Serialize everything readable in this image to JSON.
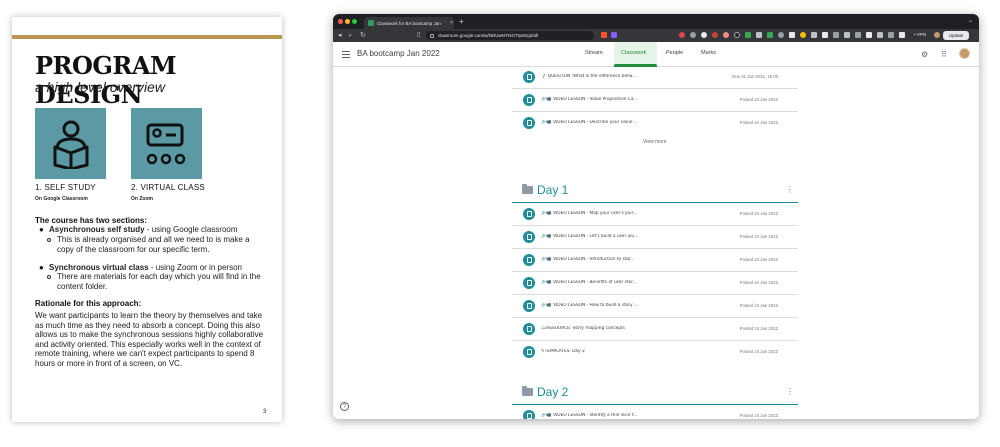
{
  "document": {
    "title": "PROGRAM DESIGN",
    "subtitle": "a high level overview",
    "cards": [
      {
        "label": "1. SELF STUDY",
        "sub": "On Google Classroom",
        "icon": "reading-person-icon"
      },
      {
        "label": "2. VIRTUAL CLASS",
        "sub": "On Zoom",
        "icon": "virtual-class-icon"
      }
    ],
    "sections_heading": "The course has two sections:",
    "bullets": [
      {
        "bold": "Asynchronous self study",
        "rest": " - using Google classroom",
        "sub": "This is already organised and all we need to is make a copy of the classroom for our specific term."
      },
      {
        "bold": "Synchronous virtual class",
        "rest": " - using Zoom or in person",
        "sub": "There are materials for each day which you will find in the content folder."
      }
    ],
    "rationale_heading": "Rationale for this approach:",
    "rationale_body": "We want participants to learn the theory by themselves and take as much time as they need to absorb a concept. Doing this also allows us to make the synchronous sessions highly collaborative and activity oriented. This especially works well in the context of remote training, where we can't expect participants to spend 8 hours or more in front of a screen, on VC.",
    "page_number": "3"
  },
  "browser": {
    "tab_title": "Classwork for BA bootcamp Jan",
    "tab_close": "×",
    "new_tab": "+",
    "url": "classroom.google.com/w/NDUwNTI4OTIyMzg3/all",
    "vpn_label": "• VPN",
    "update_label": "Update"
  },
  "classroom": {
    "class_title": "BA bootcamp Jan 2022",
    "tabs": [
      "Stream",
      "Classwork",
      "People",
      "Marks"
    ],
    "active_tab": "Classwork",
    "top_items": [
      {
        "title": "❓ QUESTION :What is the difference betw...",
        "date": "Due 31 Jan 2022, 18:00"
      },
      {
        "title": "🔗📹 VIDEO LESSON - Value Proposition Ca...",
        "date": "Posted 24 Jan 2022"
      },
      {
        "title": "🔗📹 VIDEO LESSON - Describe your value ...",
        "date": "Posted 24 Jan 2022"
      }
    ],
    "view_more": "View more",
    "topics": [
      {
        "name": "Day 1",
        "items": [
          {
            "title": "🔗📹 VIDEO LESSON - Map your user's jour...",
            "date": "Posted 24 Jan 2022"
          },
          {
            "title": "🔗📹 VIDEO LESSON - Let's build a user jou...",
            "date": "Posted 24 Jan 2022"
          },
          {
            "title": "🔗📹 VIDEO LESSON - Introduction to stor...",
            "date": "Posted 24 Jan 2022"
          },
          {
            "title": "🔗📹 VIDEO LESSON - Benefits of user stor...",
            "date": "Posted 24 Jan 2022"
          },
          {
            "title": "🔗📹 VIDEO LESSON - How to build a story ...",
            "date": "Posted 24 Jan 2022"
          },
          {
            "title": "📖RESOURCE: Story mapping concepts",
            "date": "Posted 24 Jan 2022"
          },
          {
            "title": "✎TEMPLATES: Day 2",
            "date": "Posted 24 Jan 2022"
          }
        ]
      },
      {
        "name": "Day 2",
        "items": [
          {
            "title": "🔗📹 VIDEO LESSON - Identify a thin slice t...",
            "date": "Posted 24 Jan 2022"
          }
        ]
      }
    ]
  },
  "colors": {
    "accent_gold": "#b8964e",
    "card_teal": "#5b9aa5",
    "classroom_green": "#1e8e3e",
    "classroom_teal": "#1e8e9a"
  }
}
